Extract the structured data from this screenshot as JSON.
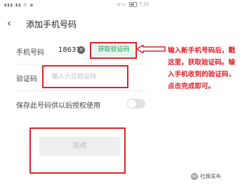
{
  "status_bar": {
    "signal": "▮▮▮ ▮▮ ✆ ◉",
    "icons": "⊙ ▭",
    "time": "7:15"
  },
  "header": {
    "back_icon": "chevron-left-icon",
    "title": "添加手机号码"
  },
  "form": {
    "phone_label": "手机号码",
    "phone_value": "18637",
    "clear_icon": "close-circle-icon",
    "get_code_label": "获取验证码",
    "code_label": "验证码",
    "code_placeholder": "输入六位验证码",
    "save_label": "保存此号码供以后授权使用",
    "save_toggle_on": false
  },
  "done_button": {
    "label": "完成"
  },
  "annotation": {
    "text": "输入新手机号码后，戳这里，获取验证码。输入手机收到的验证码，点击完成即可。",
    "color": "#e0212b"
  },
  "watermark": {
    "icon": "W",
    "text": "社旗发布"
  },
  "colors": {
    "accent_green": "#1e9b59",
    "highlight_red": "#e0212b"
  }
}
